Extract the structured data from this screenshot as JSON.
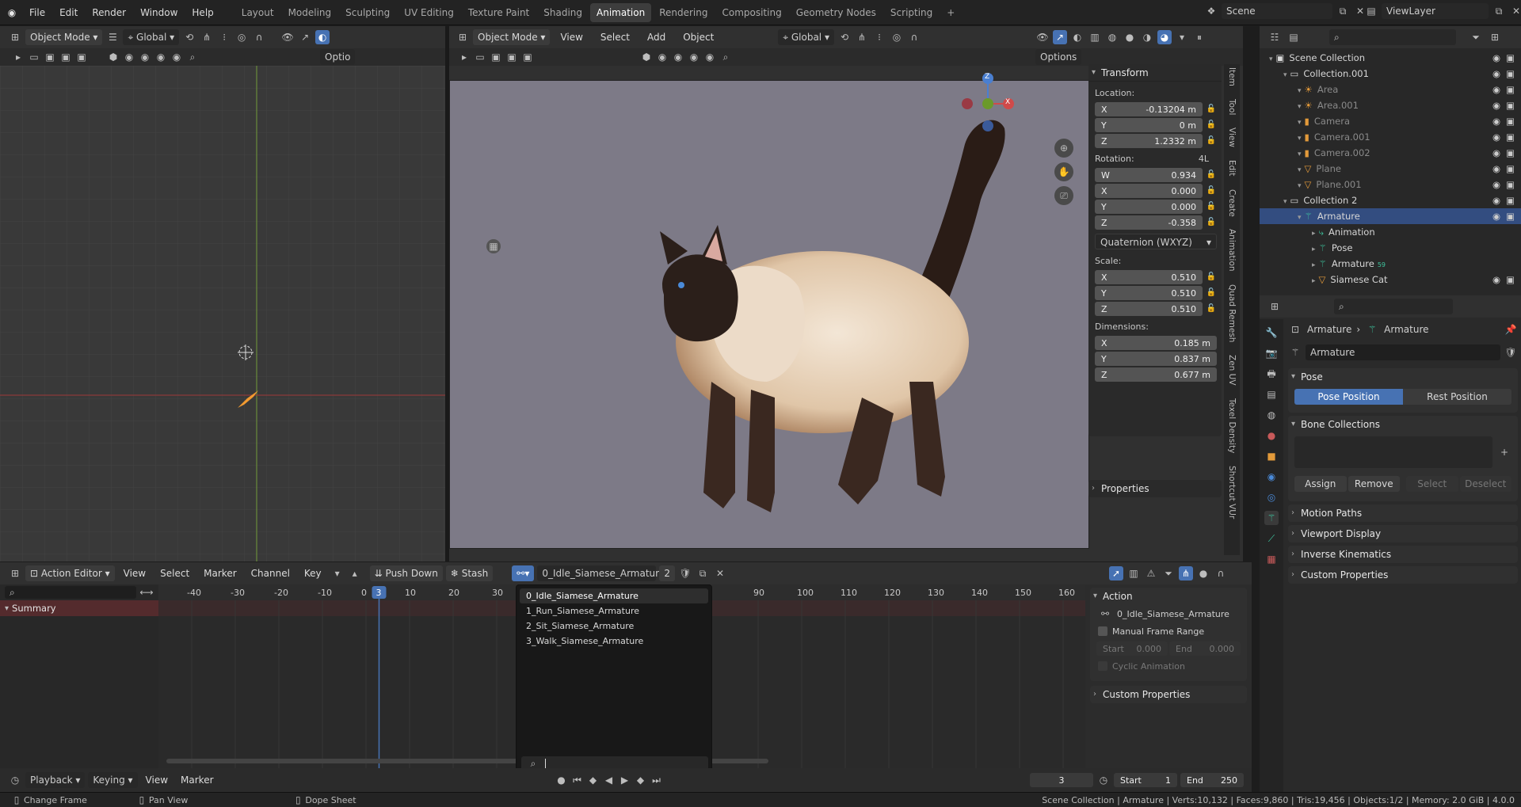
{
  "topbar": {
    "menus": [
      "File",
      "Edit",
      "Render",
      "Window",
      "Help"
    ],
    "workspaces": [
      "Layout",
      "Modeling",
      "Sculpting",
      "UV Editing",
      "Texture Paint",
      "Shading",
      "Animation",
      "Rendering",
      "Compositing",
      "Geometry Nodes",
      "Scripting"
    ],
    "active_workspace": "Animation",
    "add_tab": "+",
    "scene": "Scene",
    "view_layer": "ViewLayer"
  },
  "left_viewport": {
    "mode": "Object Mode",
    "orientation": "Global",
    "options": "Optio"
  },
  "main_viewport": {
    "mode": "Object Mode",
    "menus": [
      "View",
      "Select",
      "Add",
      "Object"
    ],
    "orientation": "Global",
    "options": "Options",
    "gizmo": {
      "z": "Z",
      "x": "X"
    },
    "side_tabs": [
      "Item",
      "Tool",
      "View",
      "Edit",
      "Create",
      "Animation",
      "Quad Remesh",
      "Zen UV",
      "Texel Density",
      "Shortcut VUr"
    ]
  },
  "transform": {
    "title": "Transform",
    "location_label": "Location:",
    "location": [
      {
        "axis": "X",
        "value": "-0.13204 m"
      },
      {
        "axis": "Y",
        "value": "0 m"
      },
      {
        "axis": "Z",
        "value": "1.2332 m"
      }
    ],
    "rotation_label": "Rotation:",
    "rotation_mode_tag": "4L",
    "rotation": [
      {
        "axis": "W",
        "value": "0.934"
      },
      {
        "axis": "X",
        "value": "0.000"
      },
      {
        "axis": "Y",
        "value": "0.000"
      },
      {
        "axis": "Z",
        "value": "-0.358"
      }
    ],
    "rotation_mode": "Quaternion (WXYZ)",
    "scale_label": "Scale:",
    "scale": [
      {
        "axis": "X",
        "value": "0.510"
      },
      {
        "axis": "Y",
        "value": "0.510"
      },
      {
        "axis": "Z",
        "value": "0.510"
      }
    ],
    "dimensions_label": "Dimensions:",
    "dimensions": [
      {
        "axis": "X",
        "value": "0.185 m"
      },
      {
        "axis": "Y",
        "value": "0.837 m"
      },
      {
        "axis": "Z",
        "value": "0.677 m"
      }
    ],
    "properties": "Properties"
  },
  "outliner": {
    "items": [
      {
        "label": "Scene Collection",
        "indent": 0,
        "type": "scene"
      },
      {
        "label": "Collection.001",
        "indent": 1,
        "type": "collection"
      },
      {
        "label": "Area",
        "indent": 2,
        "type": "light",
        "dim": true
      },
      {
        "label": "Area.001",
        "indent": 2,
        "type": "light",
        "dim": true
      },
      {
        "label": "Camera",
        "indent": 2,
        "type": "camera",
        "dim": true
      },
      {
        "label": "Camera.001",
        "indent": 2,
        "type": "camera",
        "dim": true
      },
      {
        "label": "Camera.002",
        "indent": 2,
        "type": "camera",
        "dim": true
      },
      {
        "label": "Plane",
        "indent": 2,
        "type": "mesh",
        "dim": true
      },
      {
        "label": "Plane.001",
        "indent": 2,
        "type": "mesh",
        "dim": true
      },
      {
        "label": "Collection 2",
        "indent": 1,
        "type": "collection"
      },
      {
        "label": "Armature",
        "indent": 2,
        "type": "armature",
        "selected": true
      },
      {
        "label": "Animation",
        "indent": 3,
        "type": "anim"
      },
      {
        "label": "Pose",
        "indent": 3,
        "type": "pose"
      },
      {
        "label": "Armature",
        "indent": 3,
        "type": "armdata",
        "badge": "59"
      },
      {
        "label": "Siamese Cat",
        "indent": 3,
        "type": "mesh"
      }
    ]
  },
  "properties": {
    "breadcrumb_a": "Armature",
    "breadcrumb_sep": "›",
    "breadcrumb_b": "Armature",
    "name_field": "Armature",
    "pose_title": "Pose",
    "pose_position": "Pose Position",
    "rest_position": "Rest Position",
    "bone_collections": "Bone Collections",
    "assign": "Assign",
    "remove": "Remove",
    "select": "Select",
    "deselect": "Deselect",
    "panels": [
      "Motion Paths",
      "Viewport Display",
      "Inverse Kinematics",
      "Custom Properties"
    ]
  },
  "action_editor": {
    "mode": "Action Editor",
    "menus": [
      "View",
      "Select",
      "Marker",
      "Channel",
      "Key"
    ],
    "push_down": "Push Down",
    "stash": "Stash",
    "action_name": "0_Idle_Siamese_Armature",
    "users": "2",
    "ruler": [
      "-40",
      "-30",
      "-20",
      "-10",
      "0",
      "10",
      "20",
      "30",
      "90",
      "100",
      "110",
      "120",
      "130",
      "140",
      "150",
      "160"
    ],
    "current_frame": "3",
    "summary": "Summary",
    "dropdown_items": [
      "0_Idle_Siamese_Armature",
      "1_Run_Siamese_Armature",
      "2_Sit_Siamese_Armature",
      "3_Walk_Siamese_Armature"
    ],
    "action_panel": {
      "title": "Action",
      "action": "0_Idle_Siamese_Armature",
      "manual_frame_range": "Manual Frame Range",
      "start_label": "Start",
      "start_val": "0.000",
      "end_label": "End",
      "end_val": "0.000",
      "cyclic": "Cyclic Animation",
      "custom_props": "Custom Properties"
    }
  },
  "timeline": {
    "menus": [
      "Playback",
      "Keying",
      "View",
      "Marker"
    ],
    "frame": "3",
    "start_label": "Start",
    "start": "1",
    "end_label": "End",
    "end": "250"
  },
  "statusbar": {
    "hint1": "Change Frame",
    "hint2": "Pan View",
    "hint3": "Dope Sheet",
    "info": "Scene Collection | Armature | Verts:10,132 | Faces:9,860 | Tris:19,456 | Objects:1/2 | Memory: 2.0 GiB | 4.0.0"
  },
  "colors": {
    "accent": "#4772b3",
    "viewport_bg": "#7d7a87",
    "selected": "#334d80",
    "summary": "#542b2d"
  }
}
